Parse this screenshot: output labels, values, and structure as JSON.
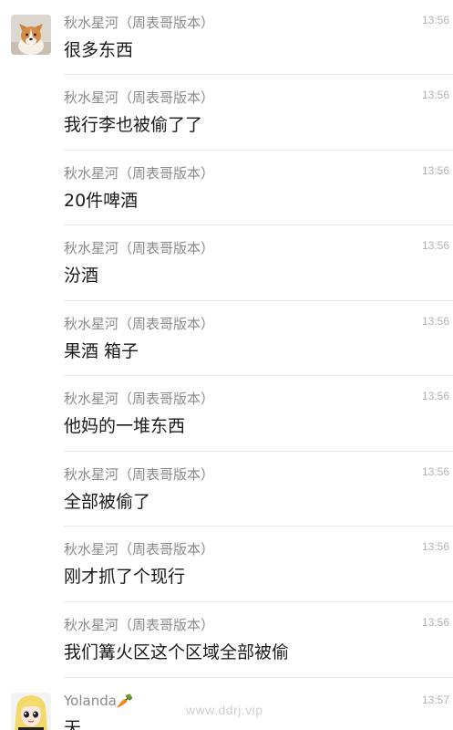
{
  "messages": [
    {
      "sender": "秋水星河（周表哥版本）",
      "time": "13:56",
      "text": "很多东西",
      "avatar": "dog-avatar"
    },
    {
      "sender": "秋水星河（周表哥版本）",
      "time": "13:56",
      "text": "我行李也被偷了了"
    },
    {
      "sender": "秋水星河（周表哥版本）",
      "time": "13:56",
      "text": "20件啤酒"
    },
    {
      "sender": "秋水星河（周表哥版本）",
      "time": "13:56",
      "text": "汾酒"
    },
    {
      "sender": "秋水星河（周表哥版本）",
      "time": "13:56",
      "text": "果酒 箱子"
    },
    {
      "sender": "秋水星河（周表哥版本）",
      "time": "13:56",
      "text": "他妈的一堆东西"
    },
    {
      "sender": "秋水星河（周表哥版本）",
      "time": "13:56",
      "text": "全部被偷了"
    },
    {
      "sender": "秋水星河（周表哥版本）",
      "time": "13:56",
      "text": "刚才抓了个现行"
    },
    {
      "sender": "秋水星河（周表哥版本）",
      "time": "13:56",
      "text": "我们篝火区这个区域全部被偷"
    },
    {
      "sender": "Yolanda🥕",
      "time": "13:57",
      "text": "天",
      "avatar": "anime-girl-avatar"
    }
  ],
  "watermark": "www.ddrj.vip"
}
